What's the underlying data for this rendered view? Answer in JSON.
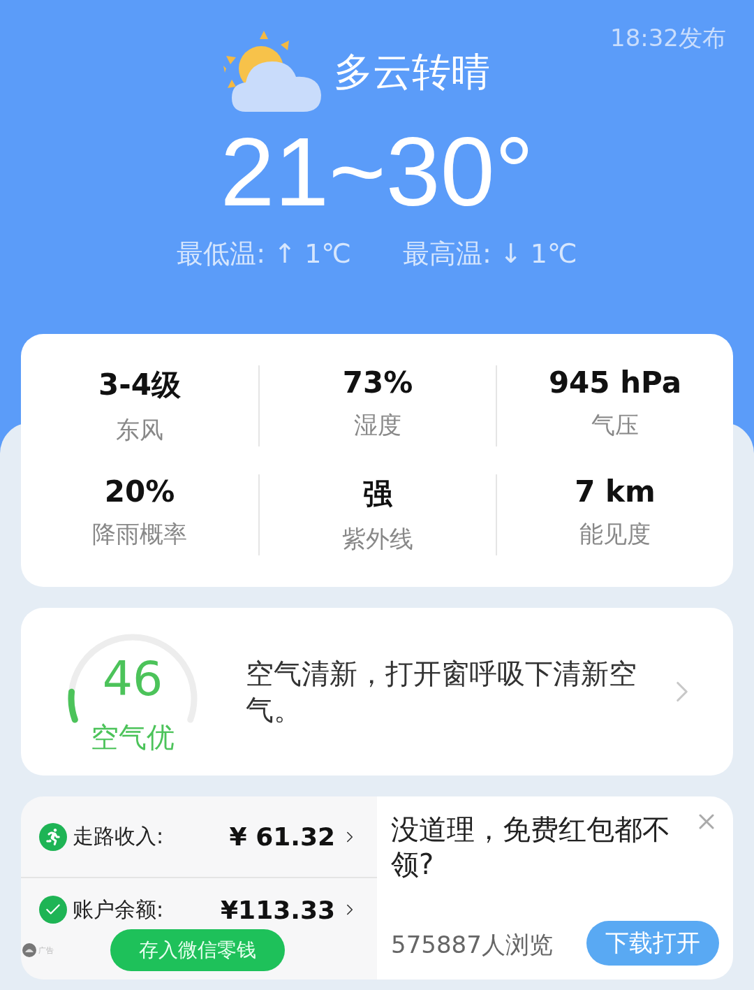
{
  "header": {
    "published": "18:32发布",
    "condition": "多云转晴",
    "temperature": "21~30°",
    "low_change": "最低温: ↑ 1℃",
    "high_change": "最高温: ↓ 1℃"
  },
  "stats": [
    {
      "value": "3-4级",
      "label": "东风"
    },
    {
      "value": "73%",
      "label": "湿度"
    },
    {
      "value": "945 hPa",
      "label": "气压"
    },
    {
      "value": "20%",
      "label": "降雨概率"
    },
    {
      "value": "强",
      "label": "紫外线"
    },
    {
      "value": "7 km",
      "label": "能见度"
    }
  ],
  "air_quality": {
    "aqi": "46",
    "grade": "空气优",
    "advice": "空气清新，打开窗呼吸下清新空气。"
  },
  "ad": {
    "rows": [
      {
        "kind": "run",
        "label": "走路收入:",
        "amount": "¥ 61.32"
      },
      {
        "kind": "check",
        "label": "账户余额:",
        "amount": "¥113.33"
      }
    ],
    "button": "存入微信零钱",
    "ad_tag": "广告",
    "title": "没道理，免费红包都不领?",
    "views": "575887人浏览",
    "download": "下载打开"
  }
}
